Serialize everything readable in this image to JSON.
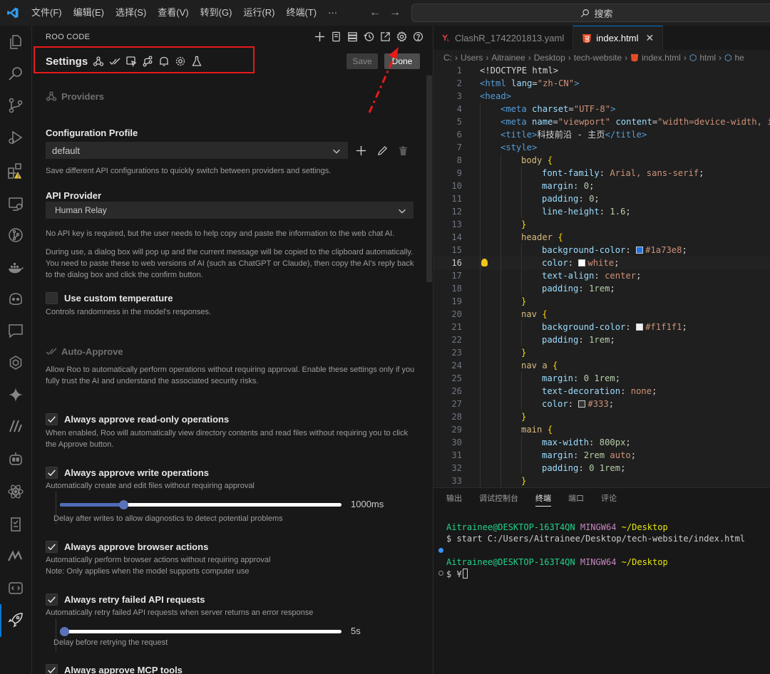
{
  "menu": [
    "文件(F)",
    "编辑(E)",
    "选择(S)",
    "查看(V)",
    "转到(G)",
    "运行(R)",
    "终端(T)",
    "···"
  ],
  "search": {
    "label": "搜索"
  },
  "roo": {
    "panel_title": "ROO CODE",
    "settings_title": "Settings",
    "save_label": "Save",
    "done_label": "Done",
    "providers_heading": "Providers",
    "config_profile_label": "Configuration Profile",
    "config_profile_value": "default",
    "config_profile_desc": "Save different API configurations to quickly switch between providers and settings.",
    "api_provider_label": "API Provider",
    "api_provider_value": "Human Relay",
    "api_provider_desc1": "No API key is required, but the user needs to help copy and paste the information to the web chat AI.",
    "api_provider_desc2": "During use, a dialog box will pop up and the current message will be copied to the clipboard automatically. You need to paste these to web versions of AI (such as ChatGPT or Claude), then copy the AI's reply back to the dialog box and click the confirm button.",
    "custom_temp_label": "Use custom temperature",
    "custom_temp_desc": "Controls randomness in the model's responses.",
    "auto_approve_heading": "Auto-Approve",
    "auto_approve_desc": "Allow Roo to automatically perform operations without requiring approval. Enable these settings only if you fully trust the AI and understand the associated security risks.",
    "readonly_label": "Always approve read-only operations",
    "readonly_desc": "When enabled, Roo will automatically view directory contents and read files without requiring you to click the Approve button.",
    "write_label": "Always approve write operations",
    "write_desc": "Automatically create and edit files without requiring approval",
    "write_delay_value": "1000ms",
    "write_delay_fraction": 0.21,
    "write_delay_desc": "Delay after writes to allow diagnostics to detect potential problems",
    "browser_label": "Always approve browser actions",
    "browser_desc1": "Automatically perform browser actions without requiring approval",
    "browser_desc2": "Note: Only applies when the model supports computer use",
    "retry_label": "Always retry failed API requests",
    "retry_desc": "Automatically retry failed API requests when server returns an error response",
    "retry_delay_value": "5s",
    "retry_delay_fraction": 0.0,
    "retry_delay_desc": "Delay before retrying the request",
    "mcp_label": "Always approve MCP tools"
  },
  "editor": {
    "tab1": "ClashR_1742201813.yaml",
    "tab2": "index.html",
    "breadcrumb": [
      "C:",
      "Users",
      "Aitrainee",
      "Desktop",
      "tech-website",
      "index.html",
      "html",
      "he"
    ],
    "current_line": 16,
    "lines": [
      {
        "n": 1,
        "i": 0,
        "t": [
          [
            "tk-txt",
            "<!DOCTYPE html>"
          ]
        ]
      },
      {
        "n": 2,
        "i": 0,
        "t": [
          [
            "tk-tag",
            "<html "
          ],
          [
            "tk-attr",
            "lang"
          ],
          [
            "tk-txt",
            "="
          ],
          [
            "tk-str",
            "\"zh-CN\""
          ],
          [
            "tk-tag",
            ">"
          ]
        ]
      },
      {
        "n": 3,
        "i": 0,
        "t": [
          [
            "tk-tag",
            "<head>"
          ]
        ]
      },
      {
        "n": 4,
        "i": 1,
        "t": [
          [
            "tk-tag",
            "<meta "
          ],
          [
            "tk-attr",
            "charset"
          ],
          [
            "tk-txt",
            "="
          ],
          [
            "tk-str",
            "\"UTF-8\""
          ],
          [
            "tk-tag",
            ">"
          ]
        ]
      },
      {
        "n": 5,
        "i": 1,
        "t": [
          [
            "tk-tag",
            "<meta "
          ],
          [
            "tk-attr",
            "name"
          ],
          [
            "tk-txt",
            "="
          ],
          [
            "tk-str",
            "\"viewport\""
          ],
          [
            "tk-txt",
            " "
          ],
          [
            "tk-attr",
            "content"
          ],
          [
            "tk-txt",
            "="
          ],
          [
            "tk-str",
            "\"width=device-width, in"
          ]
        ]
      },
      {
        "n": 6,
        "i": 1,
        "t": [
          [
            "tk-tag",
            "<title>"
          ],
          [
            "tk-txt",
            "科技前沿 - 主页"
          ],
          [
            "tk-tag",
            "</title>"
          ]
        ]
      },
      {
        "n": 7,
        "i": 1,
        "t": [
          [
            "tk-tag",
            "<style>"
          ]
        ]
      },
      {
        "n": 8,
        "i": 2,
        "t": [
          [
            "tk-sel",
            "body "
          ],
          [
            "tk-brace",
            "{"
          ]
        ]
      },
      {
        "n": 9,
        "i": 3,
        "t": [
          [
            "tk-prop",
            "font-family"
          ],
          [
            "tk-txt",
            ": "
          ],
          [
            "tk-val",
            "Arial, sans-serif"
          ],
          [
            "tk-txt",
            ";"
          ]
        ]
      },
      {
        "n": 10,
        "i": 3,
        "t": [
          [
            "tk-prop",
            "margin"
          ],
          [
            "tk-txt",
            ": "
          ],
          [
            "tk-num",
            "0"
          ],
          [
            "tk-txt",
            ";"
          ]
        ]
      },
      {
        "n": 11,
        "i": 3,
        "t": [
          [
            "tk-prop",
            "padding"
          ],
          [
            "tk-txt",
            ": "
          ],
          [
            "tk-num",
            "0"
          ],
          [
            "tk-txt",
            ";"
          ]
        ]
      },
      {
        "n": 12,
        "i": 3,
        "t": [
          [
            "tk-prop",
            "line-height"
          ],
          [
            "tk-txt",
            ": "
          ],
          [
            "tk-num",
            "1.6"
          ],
          [
            "tk-txt",
            ";"
          ]
        ]
      },
      {
        "n": 13,
        "i": 2,
        "t": [
          [
            "tk-brace",
            "}"
          ]
        ]
      },
      {
        "n": 14,
        "i": 2,
        "t": [
          [
            "tk-sel",
            "header "
          ],
          [
            "tk-brace",
            "{"
          ]
        ]
      },
      {
        "n": 15,
        "i": 3,
        "t": [
          [
            "tk-prop",
            "background-color"
          ],
          [
            "tk-txt",
            ": "
          ],
          [
            "swatch",
            "#1a73e8"
          ],
          [
            "tk-val",
            "#1a73e8"
          ],
          [
            "tk-txt",
            ";"
          ]
        ]
      },
      {
        "n": 16,
        "i": 3,
        "t": [
          [
            "tk-prop",
            "color"
          ],
          [
            "tk-txt",
            ": "
          ],
          [
            "swatch",
            "#ffffff"
          ],
          [
            "tk-val",
            "white"
          ],
          [
            "tk-txt",
            ";"
          ]
        ]
      },
      {
        "n": 17,
        "i": 3,
        "t": [
          [
            "tk-prop",
            "text-align"
          ],
          [
            "tk-txt",
            ": "
          ],
          [
            "tk-val",
            "center"
          ],
          [
            "tk-txt",
            ";"
          ]
        ]
      },
      {
        "n": 18,
        "i": 3,
        "t": [
          [
            "tk-prop",
            "padding"
          ],
          [
            "tk-txt",
            ": "
          ],
          [
            "tk-num",
            "1rem"
          ],
          [
            "tk-txt",
            ";"
          ]
        ]
      },
      {
        "n": 19,
        "i": 2,
        "t": [
          [
            "tk-brace",
            "}"
          ]
        ]
      },
      {
        "n": 20,
        "i": 2,
        "t": [
          [
            "tk-sel",
            "nav "
          ],
          [
            "tk-brace",
            "{"
          ]
        ]
      },
      {
        "n": 21,
        "i": 3,
        "t": [
          [
            "tk-prop",
            "background-color"
          ],
          [
            "tk-txt",
            ": "
          ],
          [
            "swatch",
            "#f1f1f1"
          ],
          [
            "tk-val",
            "#f1f1f1"
          ],
          [
            "tk-txt",
            ";"
          ]
        ]
      },
      {
        "n": 22,
        "i": 3,
        "t": [
          [
            "tk-prop",
            "padding"
          ],
          [
            "tk-txt",
            ": "
          ],
          [
            "tk-num",
            "1rem"
          ],
          [
            "tk-txt",
            ";"
          ]
        ]
      },
      {
        "n": 23,
        "i": 2,
        "t": [
          [
            "tk-brace",
            "}"
          ]
        ]
      },
      {
        "n": 24,
        "i": 2,
        "t": [
          [
            "tk-sel",
            "nav a "
          ],
          [
            "tk-brace",
            "{"
          ]
        ]
      },
      {
        "n": 25,
        "i": 3,
        "t": [
          [
            "tk-prop",
            "margin"
          ],
          [
            "tk-txt",
            ": "
          ],
          [
            "tk-num",
            "0 1rem"
          ],
          [
            "tk-txt",
            ";"
          ]
        ]
      },
      {
        "n": 26,
        "i": 3,
        "t": [
          [
            "tk-prop",
            "text-decoration"
          ],
          [
            "tk-txt",
            ": "
          ],
          [
            "tk-val",
            "none"
          ],
          [
            "tk-txt",
            ";"
          ]
        ]
      },
      {
        "n": 27,
        "i": 3,
        "t": [
          [
            "tk-prop",
            "color"
          ],
          [
            "tk-txt",
            ": "
          ],
          [
            "swatch",
            "#333333"
          ],
          [
            "tk-val",
            "#333"
          ],
          [
            "tk-txt",
            ";"
          ]
        ]
      },
      {
        "n": 28,
        "i": 2,
        "t": [
          [
            "tk-brace",
            "}"
          ]
        ]
      },
      {
        "n": 29,
        "i": 2,
        "t": [
          [
            "tk-sel",
            "main "
          ],
          [
            "tk-brace",
            "{"
          ]
        ]
      },
      {
        "n": 30,
        "i": 3,
        "t": [
          [
            "tk-prop",
            "max-width"
          ],
          [
            "tk-txt",
            ": "
          ],
          [
            "tk-num",
            "800px"
          ],
          [
            "tk-txt",
            ";"
          ]
        ]
      },
      {
        "n": 31,
        "i": 3,
        "t": [
          [
            "tk-prop",
            "margin"
          ],
          [
            "tk-txt",
            ": "
          ],
          [
            "tk-num",
            "2rem"
          ],
          [
            "tk-txt",
            " "
          ],
          [
            "tk-val",
            "auto"
          ],
          [
            "tk-txt",
            ";"
          ]
        ]
      },
      {
        "n": 32,
        "i": 3,
        "t": [
          [
            "tk-prop",
            "padding"
          ],
          [
            "tk-txt",
            ": "
          ],
          [
            "tk-num",
            "0 1rem"
          ],
          [
            "tk-txt",
            ";"
          ]
        ]
      },
      {
        "n": 33,
        "i": 2,
        "t": [
          [
            "tk-brace",
            "}"
          ]
        ]
      }
    ]
  },
  "panel": {
    "tabs": [
      "输出",
      "调试控制台",
      "终端",
      "端口",
      "评论"
    ],
    "active_tab": "终端",
    "term_prompt_user": "Aitrainee@DESKTOP-163T4QN",
    "term_prompt_env": "MINGW64",
    "term_prompt_path": "~/Desktop",
    "term_cmd": "$ start C:/Users/Aitrainee/Desktop/tech-website/index.html",
    "term_prompt2": "$ ¥"
  },
  "colors": {
    "accent": "#0078d4",
    "highlight": "#e81919"
  }
}
